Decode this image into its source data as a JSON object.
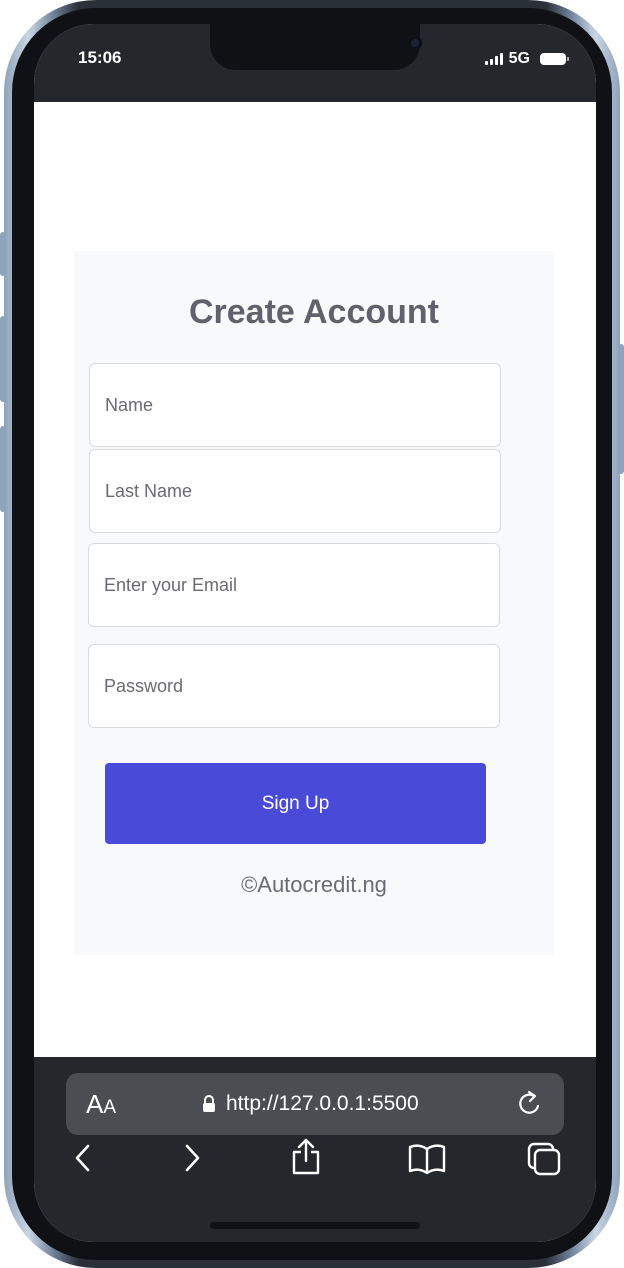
{
  "status_bar": {
    "time": "15:06",
    "network": "5G",
    "icons": [
      "signal-icon",
      "battery-icon"
    ]
  },
  "form": {
    "title": "Create Account",
    "name_placeholder": "Name",
    "last_name_placeholder": "Last Name",
    "email_placeholder": "Enter your Email",
    "password_placeholder": "Password",
    "submit_label": "Sign Up",
    "copyright": "©Autocredit.ng"
  },
  "browser": {
    "text_size_label": "A",
    "text_size_label_small": "A",
    "url": "http://127.0.0.1:5500",
    "icons": [
      "lock-icon",
      "reload-icon",
      "back-icon",
      "forward-icon",
      "share-icon",
      "bookmarks-icon",
      "tabs-icon"
    ]
  },
  "colors": {
    "accent": "#4a4ad9",
    "title": "#61616e",
    "card_bg": "#f8f9fa",
    "chrome_bg": "#24272b"
  }
}
